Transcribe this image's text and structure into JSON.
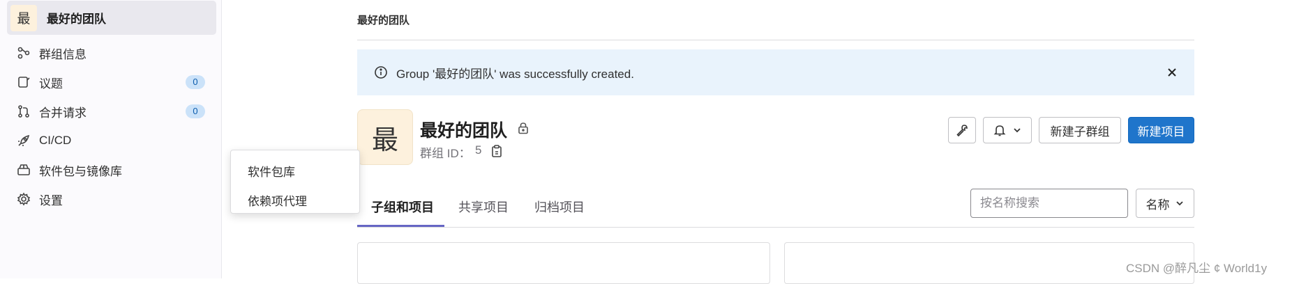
{
  "sidebar": {
    "group": {
      "avatar_letter": "最",
      "name": "最好的团队"
    },
    "items": [
      {
        "label": "群组信息",
        "icon": "group-info-icon"
      },
      {
        "label": "议题",
        "icon": "issues-icon",
        "badge": "0"
      },
      {
        "label": "合并请求",
        "icon": "merge-request-icon",
        "badge": "0"
      },
      {
        "label": "CI/CD",
        "icon": "rocket-icon"
      },
      {
        "label": "软件包与镜像库",
        "icon": "package-icon"
      },
      {
        "label": "设置",
        "icon": "gear-icon"
      }
    ],
    "flyout": {
      "items": [
        {
          "label": "软件包库"
        },
        {
          "label": "依赖项代理"
        }
      ]
    }
  },
  "breadcrumb": "最好的团队",
  "alert": {
    "text": "Group '最好的团队' was successfully created.",
    "icon": "info-icon",
    "close_icon": "close-icon"
  },
  "group": {
    "avatar_letter": "最",
    "title": "最好的团队",
    "id_label": "群组 ID：",
    "id_value": "5"
  },
  "actions": {
    "settings_icon": "wrench-icon",
    "notification_icon": "bell-icon",
    "new_subgroup": "新建子群组",
    "new_project": "新建项目"
  },
  "tabs": [
    {
      "label": "子组和项目",
      "active": true
    },
    {
      "label": "共享项目",
      "active": false
    },
    {
      "label": "归档项目",
      "active": false
    }
  ],
  "search": {
    "placeholder": "按名称搜索",
    "value": ""
  },
  "sort": {
    "label": "名称"
  },
  "watermark": "CSDN @醉凡尘 ¢ World1y",
  "colors": {
    "primary": "#1f75cb",
    "alert_bg": "#e9f3fc",
    "tab_active": "#6666c4",
    "badge_bg": "#cbe2f9"
  }
}
